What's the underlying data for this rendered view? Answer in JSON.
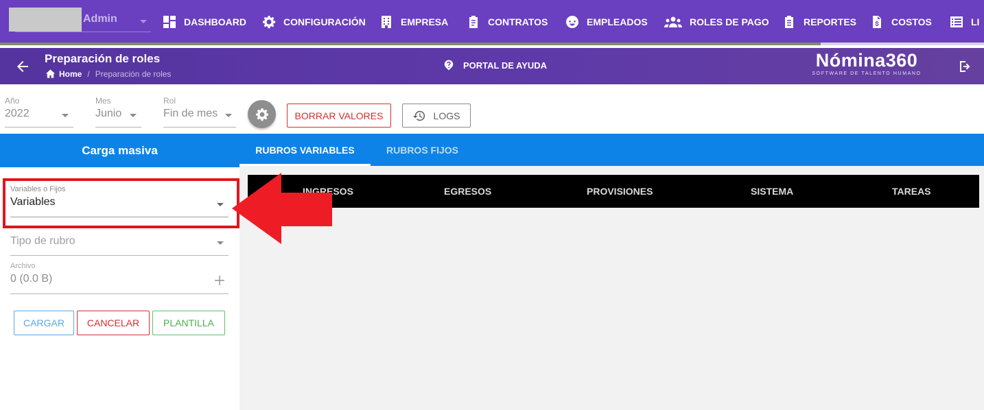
{
  "topbar": {
    "user_name": "Admin",
    "nav": [
      {
        "label": "DASHBOARD",
        "icon": "dashboard-icon"
      },
      {
        "label": "CONFIGURACIÓN",
        "icon": "gear-icon"
      },
      {
        "label": "EMPRESA",
        "icon": "building-icon"
      },
      {
        "label": "CONTRATOS",
        "icon": "clipboard-icon"
      },
      {
        "label": "EMPLEADOS",
        "icon": "face-icon"
      },
      {
        "label": "ROLES DE PAGO",
        "icon": "people-icon"
      },
      {
        "label": "REPORTES",
        "icon": "report-icon"
      },
      {
        "label": "COSTOS",
        "icon": "cost-document-icon"
      },
      {
        "label": "LI",
        "icon": "list-icon"
      }
    ]
  },
  "header": {
    "title": "Preparación de roles",
    "breadcrumb": {
      "home": "Home",
      "separator": "/",
      "current": "Preparación de roles"
    },
    "help_label": "PORTAL DE AYUDA",
    "logo_main": "Nómina360",
    "logo_sub": "SOFTWARE DE TALENTO HUMANO"
  },
  "filters": {
    "year": {
      "label": "Año",
      "value": "2022"
    },
    "month": {
      "label": "Mes",
      "value": "Junio"
    },
    "role": {
      "label": "Rol",
      "value": "Fin de mes"
    },
    "clear_label": "BORRAR VALORES",
    "logs_label": "LOGS"
  },
  "bulk_upload": {
    "title": "Carga masiva",
    "type_field": {
      "label": "Variables o Fijos",
      "value": "Variables"
    },
    "category_field": {
      "placeholder": "Tipo de rubro"
    },
    "file_field": {
      "label": "Archivo",
      "value": "0 (0.0 B)"
    },
    "buttons": {
      "load": "CARGAR",
      "cancel": "CANCELAR",
      "template": "PLANTILLA"
    }
  },
  "tabs": [
    {
      "label": "RUBROS VARIABLES",
      "active": true
    },
    {
      "label": "RUBROS FIJOS",
      "active": false
    }
  ],
  "subtabs": [
    "INGRESOS",
    "EGRESOS",
    "PROVISIONES",
    "SISTEMA",
    "TAREAS"
  ],
  "colors": {
    "nav_bg": "#6a3fc0",
    "primary_blue": "#0d83e8",
    "danger": "#d32f2f",
    "info": "#5ba6e6",
    "success": "#4caf50",
    "highlight": "#e0161e"
  }
}
